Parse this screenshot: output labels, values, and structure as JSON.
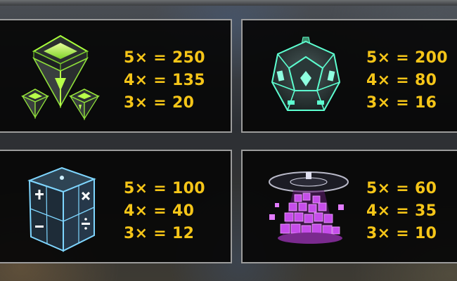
{
  "colors": {
    "payout_text": "#f5c518",
    "panel_border": "#9c9c9c",
    "panel_fill": "#0b0b0b"
  },
  "paytable": [
    {
      "symbol_icon": "green-pyramid-cluster-icon",
      "pays": [
        "5× = 250",
        "4× = 135",
        "3× = 20"
      ]
    },
    {
      "symbol_icon": "teal-dodecahedron-icon",
      "pays": [
        "5× = 200",
        "4× = 80",
        "3× = 16"
      ]
    },
    {
      "symbol_icon": "blue-math-cube-icon",
      "pays": [
        "5× = 100",
        "4× = 40",
        "3× = 12"
      ]
    },
    {
      "symbol_icon": "purple-cube-pedestal-icon",
      "pays": [
        "5× = 60",
        "4× = 35",
        "3× = 10"
      ]
    }
  ]
}
